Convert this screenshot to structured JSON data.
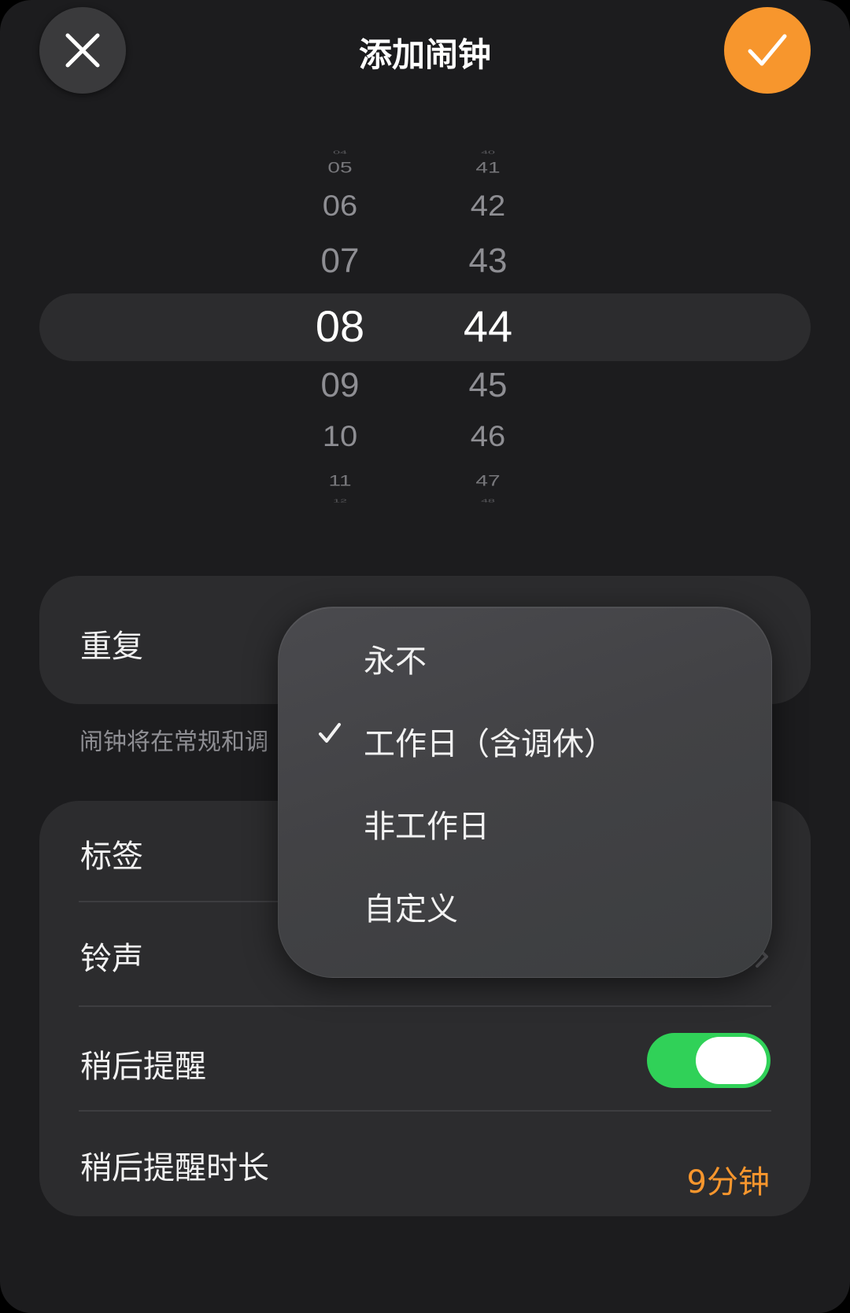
{
  "header": {
    "title": "添加闹钟",
    "close_icon": "close-icon",
    "confirm_icon": "checkmark-icon",
    "accent_color": "#f7962d"
  },
  "picker": {
    "hours": [
      "04",
      "05",
      "06",
      "07",
      "08",
      "09",
      "10",
      "11",
      "12"
    ],
    "minutes": [
      "40",
      "41",
      "42",
      "43",
      "44",
      "45",
      "46",
      "47",
      "48"
    ],
    "selected_hour": "08",
    "selected_minute": "44"
  },
  "repeat": {
    "label": "重复",
    "note": "闹钟将在常规和调"
  },
  "repeat_menu": {
    "items": [
      {
        "label": "永不",
        "checked": false
      },
      {
        "label": "工作日（含调休）",
        "checked": true
      },
      {
        "label": "非工作日",
        "checked": false
      },
      {
        "label": "自定义",
        "checked": false
      }
    ]
  },
  "settings": {
    "label_row": "标签",
    "ringtone_row": "铃声",
    "snooze_row": "稍后提醒",
    "snooze_enabled": true,
    "snooze_duration_row": "稍后提醒时长",
    "snooze_duration_value": "9分钟"
  }
}
